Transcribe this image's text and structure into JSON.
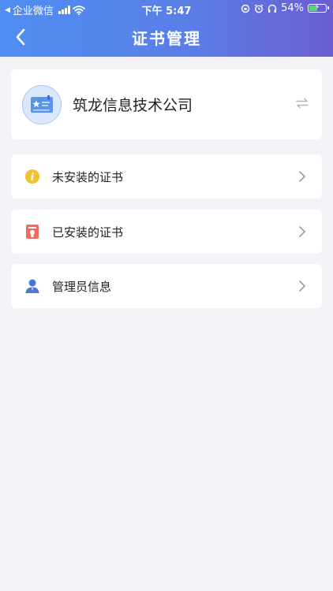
{
  "status_bar": {
    "carrier": "企业微信",
    "time": "下午 5:47",
    "battery": "54%",
    "battery_level": 0.54
  },
  "header": {
    "title": "证书管理",
    "back_icon": "chevron-left-icon"
  },
  "company": {
    "name": "筑龙信息技术公司",
    "avatar_icon": "certificate-card-icon",
    "switch_icon": "swap-arrows-icon"
  },
  "menu": [
    {
      "label": "未安装的证书",
      "icon": "info-circle-icon",
      "icon_color": "#f2c12e"
    },
    {
      "label": "已安装的证书",
      "icon": "certificate-box-icon",
      "icon_color": "#ee6b5e"
    },
    {
      "label": "管理员信息",
      "icon": "user-icon",
      "icon_color": "#4a78d9"
    }
  ],
  "colors": {
    "header_start": "#4f8ef2",
    "header_end": "#6a5dd3",
    "background": "#f2f2f7"
  }
}
